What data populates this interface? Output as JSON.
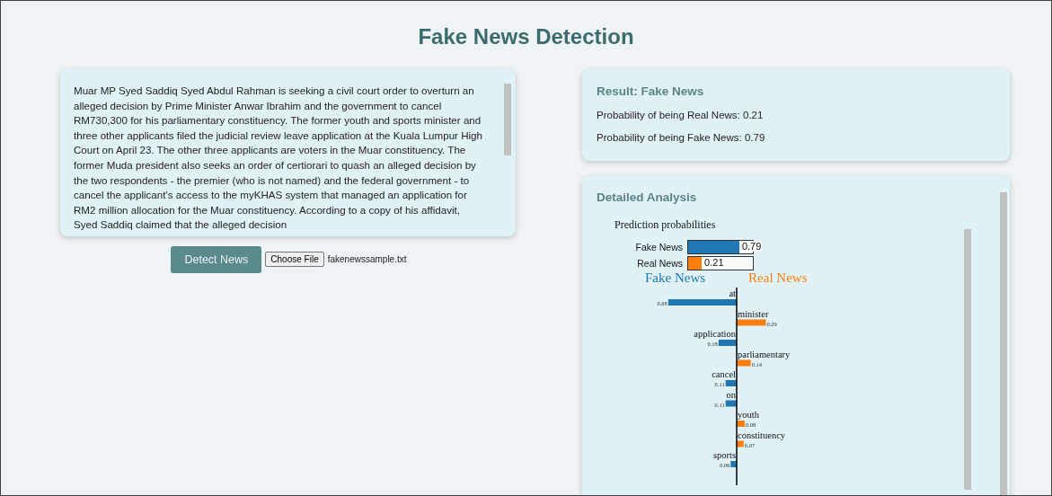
{
  "title": "Fake News Detection",
  "article": {
    "text": "Muar MP Syed Saddiq Syed Abdul Rahman is seeking a civil court order to overturn an alleged decision by Prime Minister Anwar Ibrahim and the government to cancel RM730,300 for his parliamentary constituency. The former youth and sports minister and three other applicants filed the judicial review leave application at the Kuala Lumpur High Court on April 23. The other three applicants are voters in the Muar constituency. The former Muda president also seeks an order of certiorari to quash an alleged decision by the two respondents - the premier (who is not named) and the federal government - to cancel the applicant's access to the myKHAS system that managed an application for RM2 million allocation for the Muar constituency. According to a copy of his affidavit, Syed Saddiq claimed that the alleged decision"
  },
  "detect_button": "Detect News",
  "file_input": {
    "button": "Choose File",
    "file_name": "fakenewssample.txt"
  },
  "result": {
    "title": "Result: Fake News",
    "lines": [
      "Probability of being Real News: 0.21",
      "Probability of being Fake News: 0.79"
    ]
  },
  "analysis": {
    "title": "Detailed Analysis",
    "probabilities_title": "Prediction probabilities",
    "probabilities": [
      {
        "label": "Fake News",
        "level": 0.79,
        "reading": "0.79",
        "color": "#1f77b4"
      },
      {
        "label": "Real News",
        "level": 0.21,
        "reading": "0.21",
        "color": "#ff7f0e"
      }
    ],
    "classes": [
      {
        "name": "Fake News",
        "color": "#1f77b4"
      },
      {
        "name": "Real News",
        "color": "#ff7f0e"
      }
    ],
    "features": [
      {
        "word": "at",
        "kind": "fake",
        "weight": "0.68"
      },
      {
        "word": "minister",
        "kind": "real",
        "weight": "0.29"
      },
      {
        "word": "application",
        "kind": "fake",
        "weight": "0.18"
      },
      {
        "word": "parliamentary",
        "kind": "real",
        "weight": "0.14"
      },
      {
        "word": "cancel",
        "kind": "fake",
        "weight": "0.11"
      },
      {
        "word": "on",
        "kind": "fake",
        "weight": "0.11"
      },
      {
        "word": "youth",
        "kind": "real",
        "weight": "0.08"
      },
      {
        "word": "constituency",
        "kind": "real",
        "weight": "0.07"
      },
      {
        "word": "sports",
        "kind": "fake",
        "weight": "0.06"
      }
    ]
  }
}
